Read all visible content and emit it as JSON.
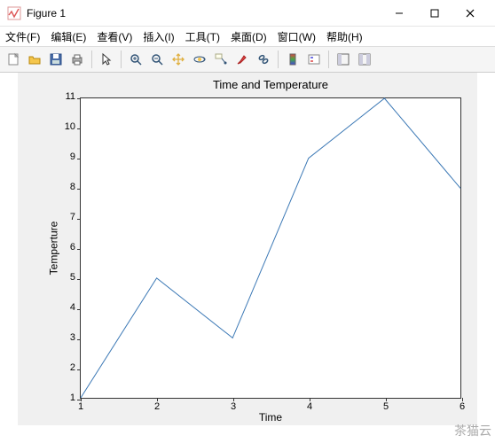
{
  "window": {
    "title": "Figure 1"
  },
  "menus": {
    "file": "文件(F)",
    "edit": "编辑(E)",
    "view": "查看(V)",
    "insert": "插入(I)",
    "tools": "工具(T)",
    "desktop": "桌面(D)",
    "window": "窗口(W)",
    "help": "帮助(H)"
  },
  "chart_data": {
    "type": "line",
    "title": "Time and Temperature",
    "xlabel": "Time",
    "ylabel": "Temperture",
    "x": [
      1,
      2,
      3,
      4,
      5,
      6
    ],
    "y": [
      1,
      5,
      3,
      9,
      11,
      8
    ],
    "xlim": [
      1,
      6
    ],
    "ylim": [
      1,
      11
    ],
    "xticks": [
      1,
      2,
      3,
      4,
      5,
      6
    ],
    "yticks": [
      1,
      2,
      3,
      4,
      5,
      6,
      7,
      8,
      9,
      10,
      11
    ]
  },
  "watermark": "茶猫云"
}
